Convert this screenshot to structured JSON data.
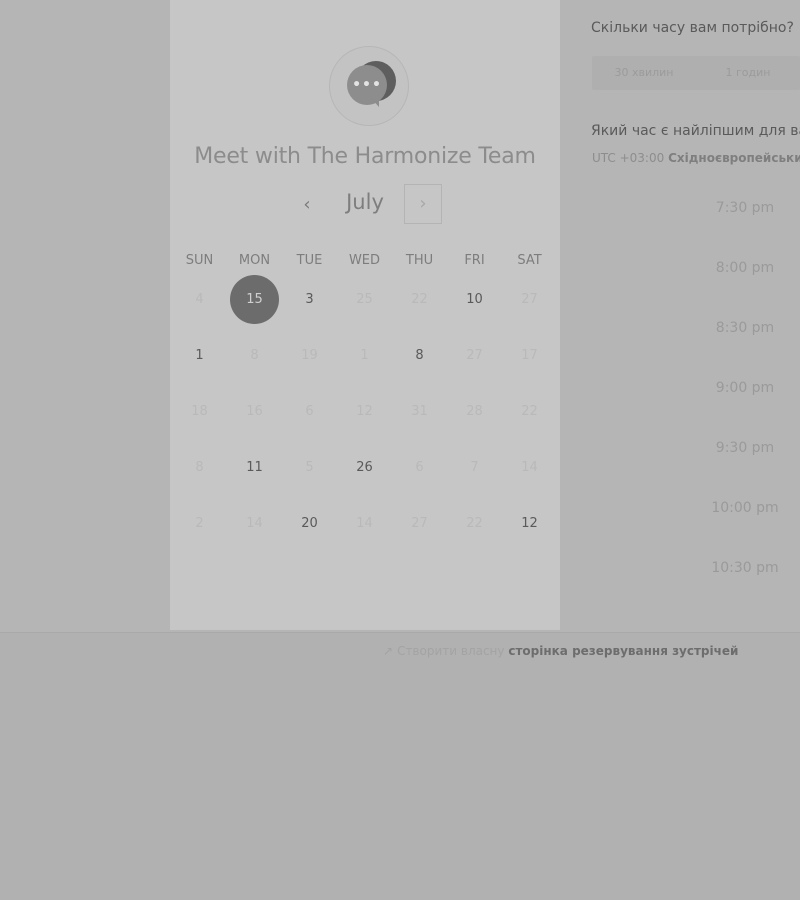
{
  "card": {
    "title": "Meet with The Harmonize Team",
    "avatar_icon": "chat-bubble-icon",
    "avatar_dots": "•••"
  },
  "calendar": {
    "month": "July",
    "prev_icon": "‹",
    "next_icon": "›",
    "weekdays": [
      "SUN",
      "MON",
      "TUE",
      "WED",
      "THU",
      "FRI",
      "SAT"
    ],
    "weeks": [
      [
        "4",
        "15",
        "3",
        "25",
        "22",
        "10",
        "27"
      ],
      [
        "1",
        "8",
        "19",
        "1",
        "8",
        "27",
        "17"
      ],
      [
        "18",
        "16",
        "6",
        "12",
        "31",
        "28",
        "22"
      ],
      [
        "8",
        "11",
        "5",
        "26",
        "6",
        "7",
        "14"
      ],
      [
        "2",
        "14",
        "20",
        "14",
        "27",
        "22",
        "12"
      ]
    ],
    "selected": "15"
  },
  "duration": {
    "question": "Скільки часу вам потрібно?",
    "options": [
      "30 хвилин",
      "1 годин"
    ]
  },
  "time": {
    "question": "Який час є найліпшим для вас?",
    "timezone_offset": "UTC +03:00",
    "timezone_name": "Східноєвропейський час",
    "slots": [
      "7:30 pm",
      "8:00 pm",
      "8:30 pm",
      "9:00 pm",
      "9:30 pm",
      "10:00 pm",
      "10:30 pm"
    ]
  },
  "footer": {
    "icon": "↗",
    "part1": "Створити власну",
    "part2": "сторінка резервування зустрічей"
  }
}
